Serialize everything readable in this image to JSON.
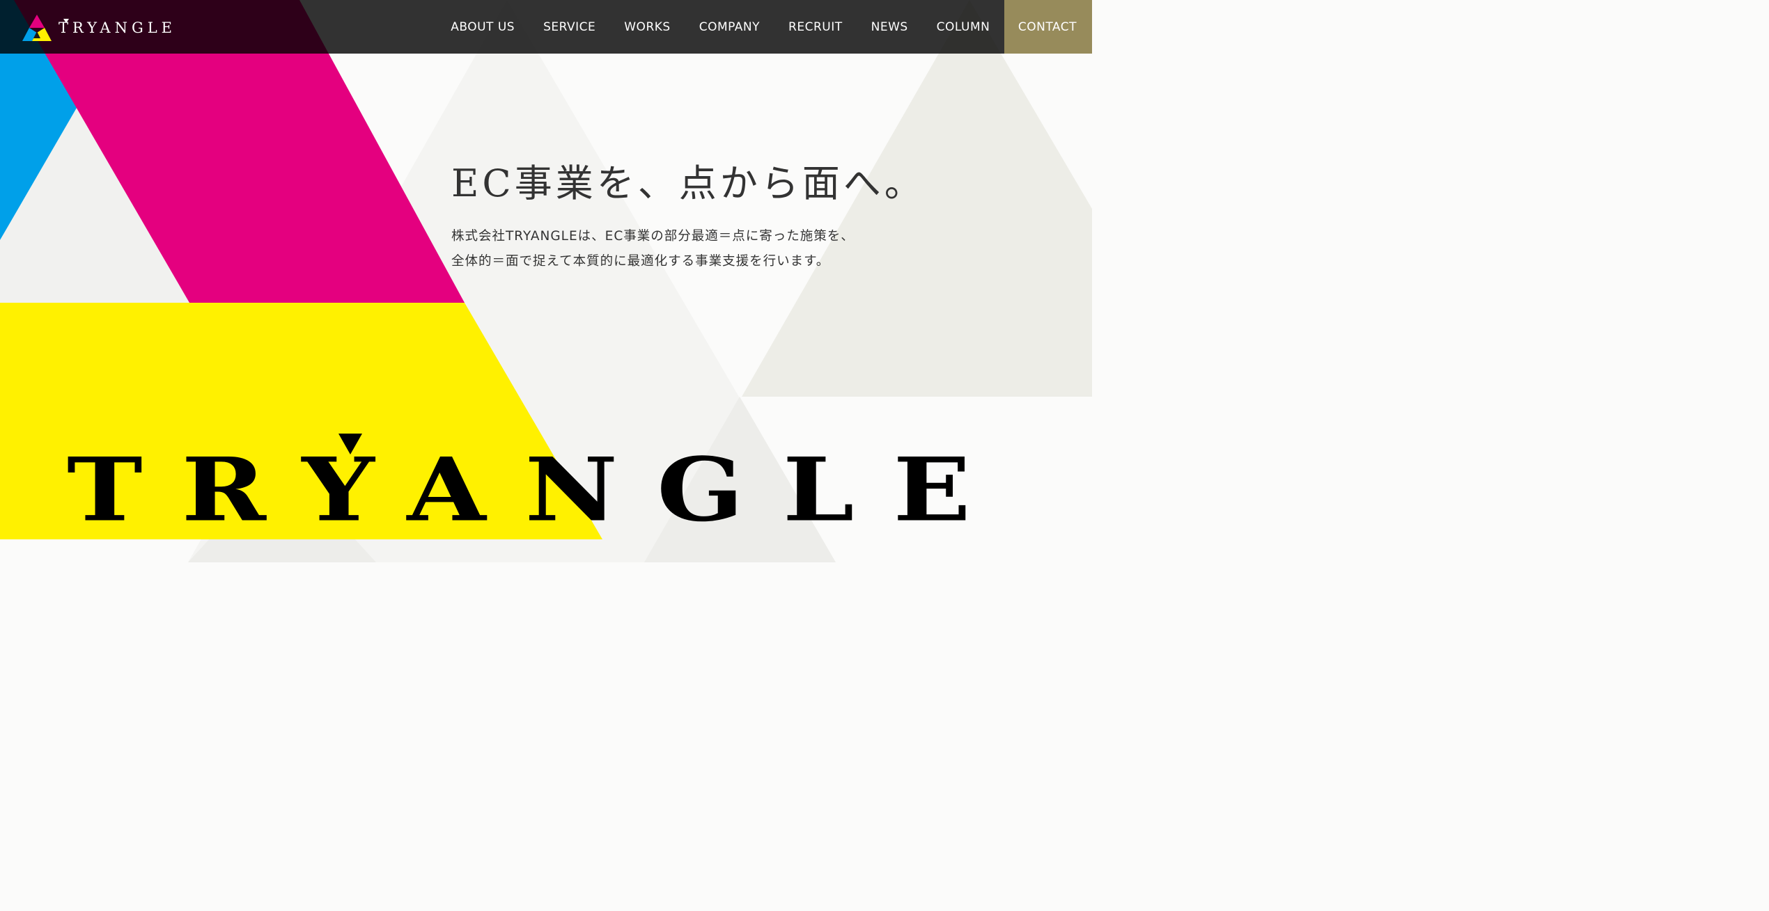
{
  "brand": {
    "logo_text": "TRYANGLE",
    "logo_icon": "tryangle-cmy-triangle-logo",
    "colors": {
      "cyan": "#00a0e9",
      "magenta": "#e4007f",
      "yellow": "#fff100",
      "header_bg": "#000000",
      "contact_bg": "#978b5b",
      "text": "#333333"
    }
  },
  "nav": {
    "items": [
      {
        "label": "ABOUT US"
      },
      {
        "label": "SERVICE"
      },
      {
        "label": "WORKS"
      },
      {
        "label": "COMPANY"
      },
      {
        "label": "RECRUIT"
      },
      {
        "label": "NEWS"
      },
      {
        "label": "COLUMN"
      }
    ],
    "contact_label": "CONTACT"
  },
  "hero": {
    "title": "EC事業を、点から面へ。",
    "description_lines": [
      "株式会社TRYANGLEは、EC事業の部分最適＝点に寄った施策を、",
      "全体的＝面で捉えて本質的に最適化する事業支援を行います。"
    ],
    "wordmark": "TRYANGLE"
  }
}
